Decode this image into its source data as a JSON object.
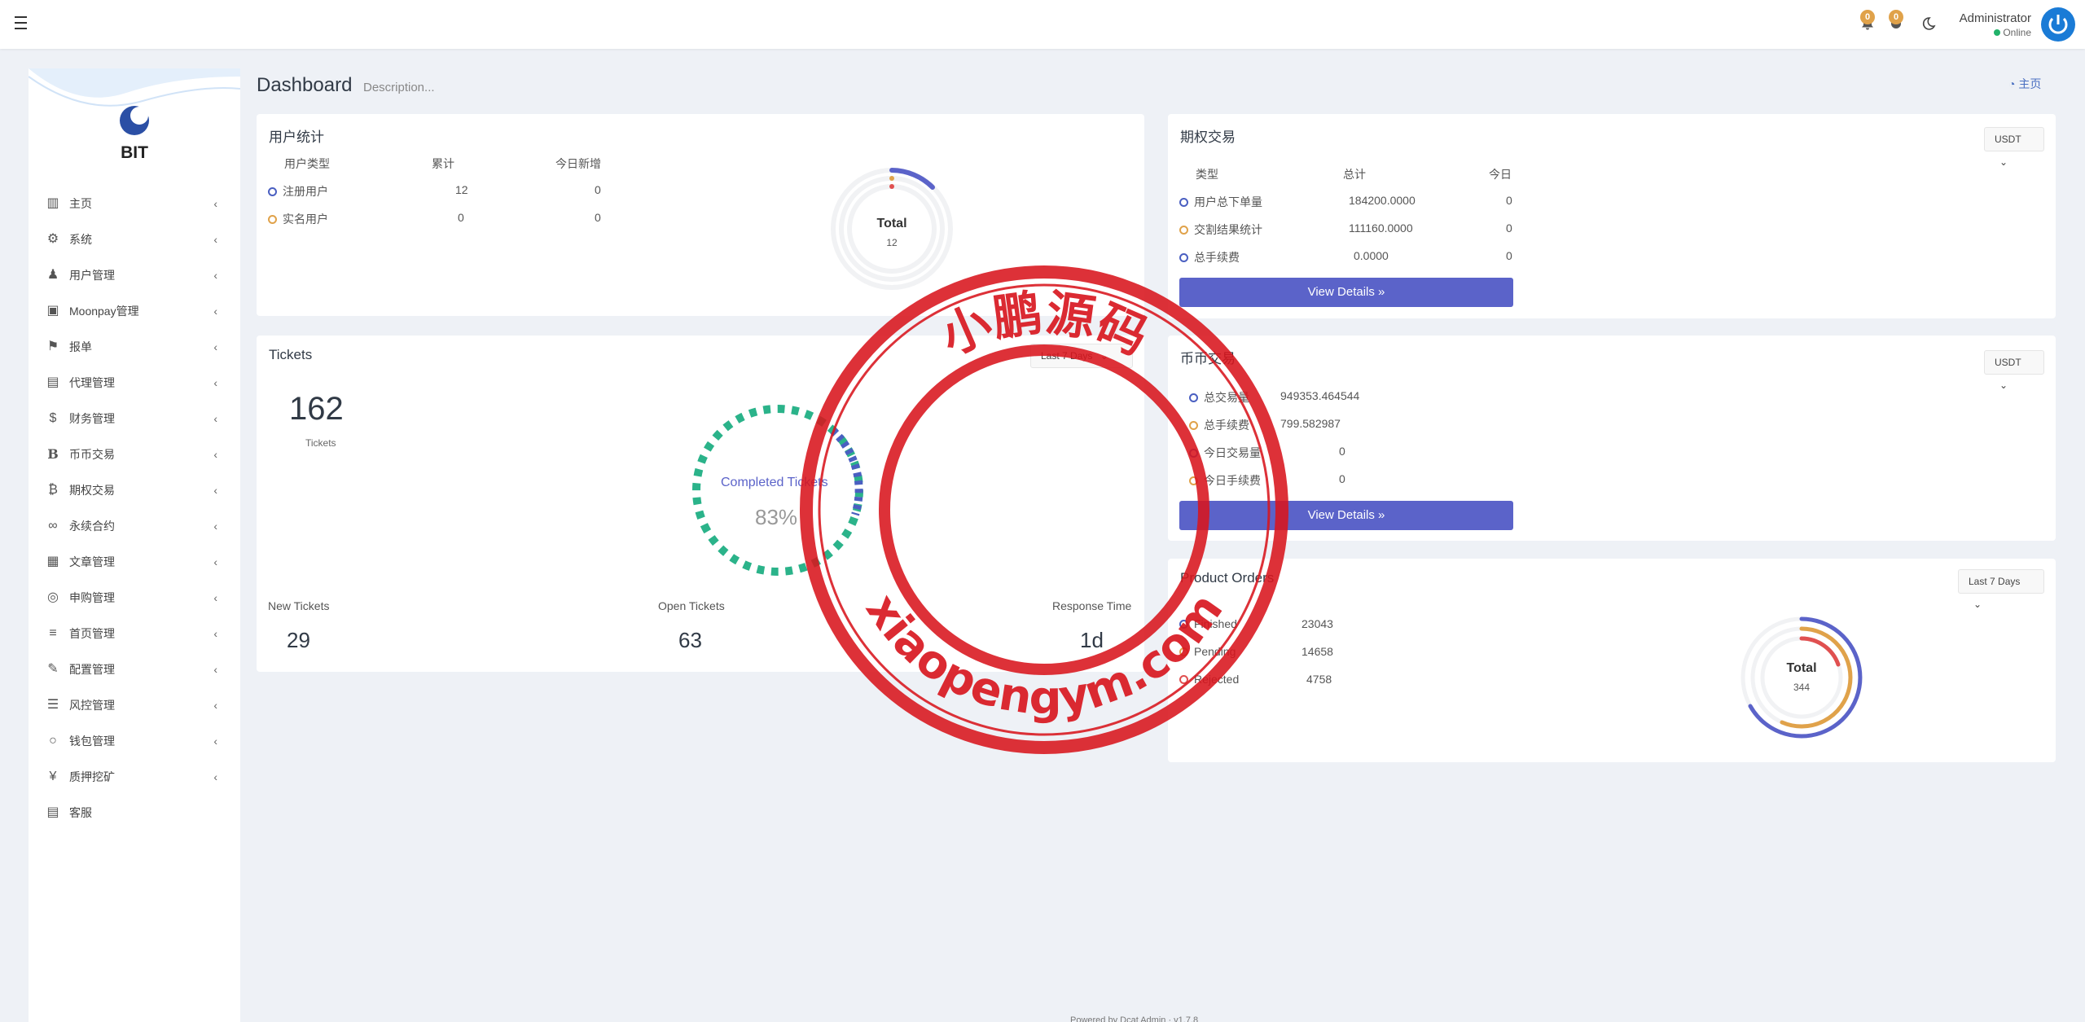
{
  "header": {
    "notif_count_1": "0",
    "notif_count_2": "0",
    "user_name": "Administrator",
    "user_status": "Online"
  },
  "sidebar": {
    "brand": "BIT",
    "items": [
      {
        "label": "主页"
      },
      {
        "label": "系统"
      },
      {
        "label": "用户管理"
      },
      {
        "label": "Moonpay管理"
      },
      {
        "label": "报单"
      },
      {
        "label": "代理管理"
      },
      {
        "label": "财务管理"
      },
      {
        "label": "币币交易"
      },
      {
        "label": "期权交易"
      },
      {
        "label": "永续合约"
      },
      {
        "label": "文章管理"
      },
      {
        "label": "申购管理"
      },
      {
        "label": "首页管理"
      },
      {
        "label": "配置管理"
      },
      {
        "label": "风控管理"
      },
      {
        "label": "钱包管理"
      },
      {
        "label": "质押挖矿"
      },
      {
        "label": "客服"
      }
    ]
  },
  "page": {
    "title": "Dashboard",
    "description": "Description...",
    "breadcrumb": "主页"
  },
  "user_stats": {
    "title": "用户统计",
    "headers": [
      "用户类型",
      "累计",
      "今日新增"
    ],
    "rows": [
      {
        "type": "注册用户",
        "total": "12",
        "today": "0"
      },
      {
        "type": "实名用户",
        "total": "0",
        "today": "0"
      }
    ],
    "donut": {
      "label": "Total",
      "value": "12"
    }
  },
  "options": {
    "title": "期权交易",
    "currency": "USDT",
    "headers": [
      "类型",
      "总计",
      "今日"
    ],
    "rows": [
      {
        "type": "用户总下单量",
        "total": "184200.0000",
        "today": "0"
      },
      {
        "type": "交割结果统计",
        "total": "111160.0000",
        "today": "0"
      },
      {
        "type": "总手续费",
        "total": "0.0000",
        "today": "0"
      }
    ],
    "button": "View Details »"
  },
  "tickets": {
    "title": "Tickets",
    "range": "Last 7 Days",
    "total": "162",
    "total_label": "Tickets",
    "ring_label": "Completed Tickets",
    "ring_value": "83%",
    "stats": [
      {
        "label": "New Tickets",
        "value": "29"
      },
      {
        "label": "Open Tickets",
        "value": "63"
      },
      {
        "label": "Response Time",
        "value": "1d"
      }
    ]
  },
  "spot": {
    "title": "币币交易",
    "currency": "USDT",
    "rows": [
      {
        "label": "总交易量",
        "value": "949353.464544"
      },
      {
        "label": "总手续费",
        "value": "799.582987"
      },
      {
        "label": "今日交易量",
        "value": "0"
      },
      {
        "label": "今日手续费",
        "value": "0"
      }
    ],
    "button": "View Details »"
  },
  "product_orders": {
    "title": "Product Orders",
    "range": "Last 7 Days",
    "rows": [
      {
        "label": "Finished",
        "value": "23043"
      },
      {
        "label": "Pending",
        "value": "14658"
      },
      {
        "label": "Rejected",
        "value": "4758"
      }
    ],
    "donut": {
      "label": "Total",
      "value": "344"
    }
  },
  "footer": {
    "text": "Powered by Dcat Admin · v1.7.8"
  },
  "watermark": {
    "top_text": "小鹏源码",
    "bottom_text": "xiaopengym.com"
  },
  "colors": {
    "primary": "#5b63c9",
    "blue": "#4a5fc1",
    "orange": "#e0a24a",
    "red": "#e05050",
    "green": "#2bb38a",
    "stamp": "#d8141c"
  }
}
